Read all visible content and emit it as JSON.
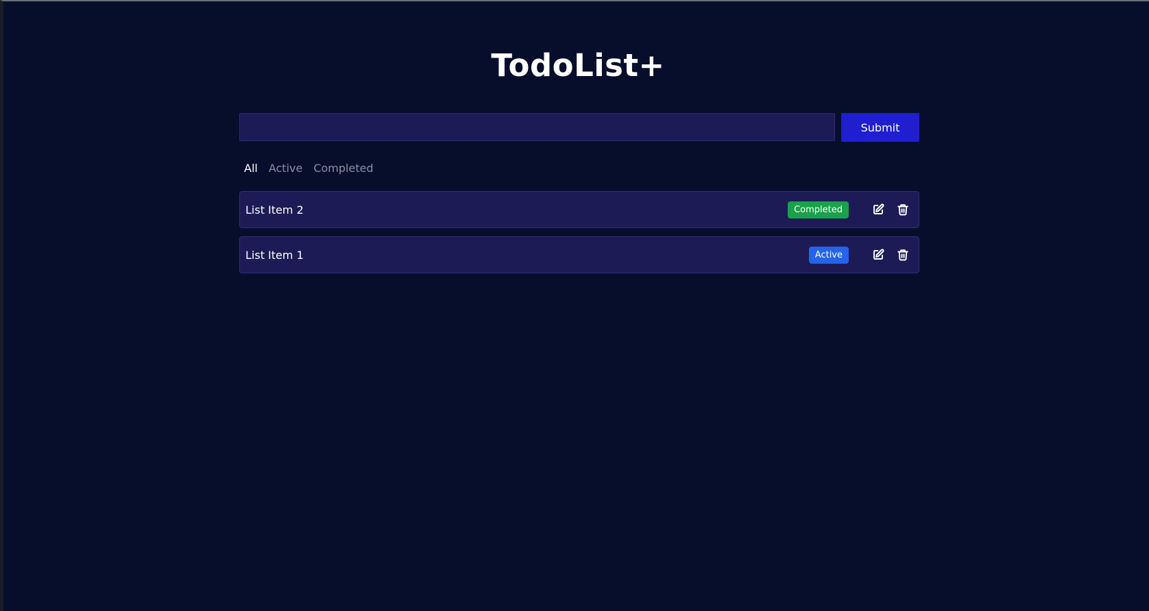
{
  "app": {
    "title": "TodoList+"
  },
  "form": {
    "input_value": "",
    "input_placeholder": "",
    "submit_label": "Submit"
  },
  "filters": {
    "items": [
      {
        "label": "All",
        "selected": true
      },
      {
        "label": "Active",
        "selected": false
      },
      {
        "label": "Completed",
        "selected": false
      }
    ]
  },
  "todos": [
    {
      "label": "List Item 2",
      "status": "Completed",
      "status_color": "#16a34a"
    },
    {
      "label": "List Item 1",
      "status": "Active",
      "status_color": "#2563eb"
    }
  ],
  "icons": {
    "edit": "edit-icon",
    "delete": "trash-icon"
  },
  "colors": {
    "background": "#070e2c",
    "panel": "#1d1b55",
    "accent": "#1f1fcf",
    "completed": "#16a34a",
    "active": "#2563eb"
  }
}
